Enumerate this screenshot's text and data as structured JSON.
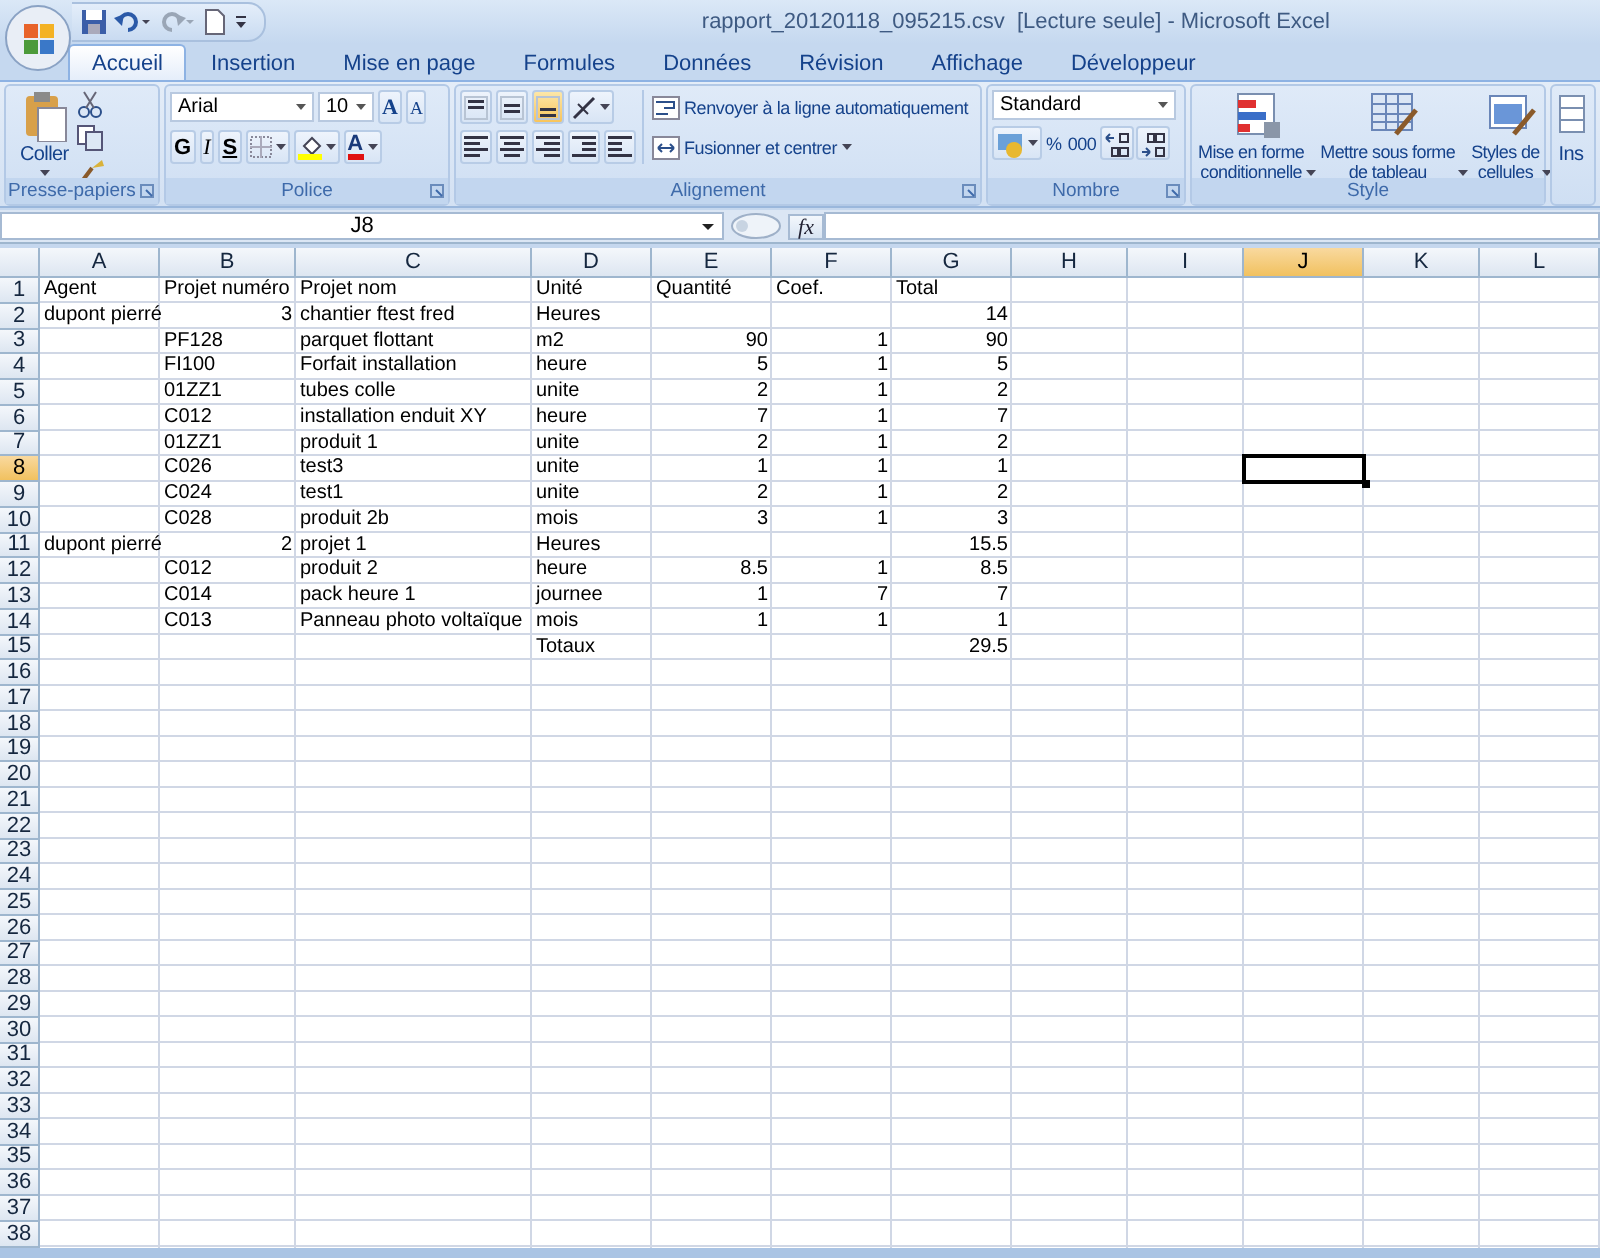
{
  "window": {
    "title": "rapport_20120118_095215.csv  [Lecture seule] - Microsoft Excel"
  },
  "tabs": [
    {
      "label": "Accueil",
      "selected": true
    },
    {
      "label": "Insertion",
      "selected": false
    },
    {
      "label": "Mise en page",
      "selected": false
    },
    {
      "label": "Formules",
      "selected": false
    },
    {
      "label": "Données",
      "selected": false
    },
    {
      "label": "Révision",
      "selected": false
    },
    {
      "label": "Affichage",
      "selected": false
    },
    {
      "label": "Développeur",
      "selected": false
    }
  ],
  "ribbon": {
    "clipboard": {
      "title": "Presse-papiers",
      "paste": "Coller"
    },
    "font": {
      "title": "Police",
      "font_name": "Arial",
      "font_size": "10",
      "grow": "A",
      "shrink": "A",
      "bold": "G",
      "italic": "I",
      "underline": "S",
      "font_color": "A"
    },
    "alignment": {
      "title": "Alignement",
      "wrap": "Renvoyer à la ligne automatiquement",
      "merge": "Fusionner et centrer"
    },
    "number": {
      "title": "Nombre",
      "format": "Standard",
      "percent": "%",
      "thousands": "000"
    },
    "style": {
      "title": "Style",
      "buttons": [
        {
          "label": "Mise en forme\nconditionnelle",
          "kind": "conditional"
        },
        {
          "label": "Mettre sous forme\nde tableau",
          "kind": "table"
        },
        {
          "label": "Styles de\ncellules",
          "kind": "cells"
        }
      ]
    },
    "cells_group": {
      "insert": "Ins"
    }
  },
  "formula_bar": {
    "name_box": "J8",
    "fx": "fx"
  },
  "columns": [
    {
      "label": "A",
      "selected": false
    },
    {
      "label": "B",
      "selected": false
    },
    {
      "label": "C",
      "selected": false
    },
    {
      "label": "D",
      "selected": false
    },
    {
      "label": "E",
      "selected": false
    },
    {
      "label": "F",
      "selected": false
    },
    {
      "label": "G",
      "selected": false
    },
    {
      "label": "H",
      "selected": false
    },
    {
      "label": "I",
      "selected": false
    },
    {
      "label": "J",
      "selected": true
    },
    {
      "label": "K",
      "selected": false
    },
    {
      "label": "L",
      "selected": false
    }
  ],
  "rows": [
    {
      "header": "1",
      "selected": false,
      "cells": {
        "A": {
          "text": "Agent",
          "kind": "text"
        },
        "B": {
          "text": "Projet numéro",
          "kind": "text"
        },
        "C": {
          "text": "Projet nom",
          "kind": "text"
        },
        "D": {
          "text": "Unité",
          "kind": "text"
        },
        "E": {
          "text": "Quantité",
          "kind": "text"
        },
        "F": {
          "text": "Coef.",
          "kind": "text"
        },
        "G": {
          "text": "Total",
          "kind": "text"
        }
      }
    },
    {
      "header": "2",
      "selected": false,
      "cells": {
        "A": {
          "text": "dupont pierré",
          "kind": "text"
        },
        "B": {
          "text": "3",
          "kind": "number"
        },
        "C": {
          "text": "chantier ftest fred",
          "kind": "text"
        },
        "D": {
          "text": "Heures",
          "kind": "text"
        },
        "G": {
          "text": "14",
          "kind": "number"
        }
      }
    },
    {
      "header": "3",
      "selected": false,
      "cells": {
        "B": {
          "text": "PF128",
          "kind": "text"
        },
        "C": {
          "text": "parquet flottant",
          "kind": "text"
        },
        "D": {
          "text": "m2",
          "kind": "text"
        },
        "E": {
          "text": "90",
          "kind": "number"
        },
        "F": {
          "text": "1",
          "kind": "number"
        },
        "G": {
          "text": "90",
          "kind": "number"
        }
      }
    },
    {
      "header": "4",
      "selected": false,
      "cells": {
        "B": {
          "text": "FI100",
          "kind": "text"
        },
        "C": {
          "text": "Forfait installation",
          "kind": "text"
        },
        "D": {
          "text": "heure",
          "kind": "text"
        },
        "E": {
          "text": "5",
          "kind": "number"
        },
        "F": {
          "text": "1",
          "kind": "number"
        },
        "G": {
          "text": "5",
          "kind": "number"
        }
      }
    },
    {
      "header": "5",
      "selected": false,
      "cells": {
        "B": {
          "text": "01ZZ1",
          "kind": "text"
        },
        "C": {
          "text": "tubes colle",
          "kind": "text"
        },
        "D": {
          "text": "unite",
          "kind": "text"
        },
        "E": {
          "text": "2",
          "kind": "number"
        },
        "F": {
          "text": "1",
          "kind": "number"
        },
        "G": {
          "text": "2",
          "kind": "number"
        }
      }
    },
    {
      "header": "6",
      "selected": false,
      "cells": {
        "B": {
          "text": "C012",
          "kind": "text"
        },
        "C": {
          "text": "installation enduit XY",
          "kind": "text"
        },
        "D": {
          "text": "heure",
          "kind": "text"
        },
        "E": {
          "text": "7",
          "kind": "number"
        },
        "F": {
          "text": "1",
          "kind": "number"
        },
        "G": {
          "text": "7",
          "kind": "number"
        }
      }
    },
    {
      "header": "7",
      "selected": false,
      "cells": {
        "B": {
          "text": "01ZZ1",
          "kind": "text"
        },
        "C": {
          "text": "produit 1",
          "kind": "text"
        },
        "D": {
          "text": "unite",
          "kind": "text"
        },
        "E": {
          "text": "2",
          "kind": "number"
        },
        "F": {
          "text": "1",
          "kind": "number"
        },
        "G": {
          "text": "2",
          "kind": "number"
        }
      }
    },
    {
      "header": "8",
      "selected": true,
      "cells": {
        "B": {
          "text": "C026",
          "kind": "text"
        },
        "C": {
          "text": "test3",
          "kind": "text"
        },
        "D": {
          "text": "unite",
          "kind": "text"
        },
        "E": {
          "text": "1",
          "kind": "number"
        },
        "F": {
          "text": "1",
          "kind": "number"
        },
        "G": {
          "text": "1",
          "kind": "number"
        }
      }
    },
    {
      "header": "9",
      "selected": false,
      "cells": {
        "B": {
          "text": "C024",
          "kind": "text"
        },
        "C": {
          "text": "test1",
          "kind": "text"
        },
        "D": {
          "text": "unite",
          "kind": "text"
        },
        "E": {
          "text": "2",
          "kind": "number"
        },
        "F": {
          "text": "1",
          "kind": "number"
        },
        "G": {
          "text": "2",
          "kind": "number"
        }
      }
    },
    {
      "header": "10",
      "selected": false,
      "cells": {
        "B": {
          "text": "C028",
          "kind": "text"
        },
        "C": {
          "text": "produit 2b",
          "kind": "text"
        },
        "D": {
          "text": "mois",
          "kind": "text"
        },
        "E": {
          "text": "3",
          "kind": "number"
        },
        "F": {
          "text": "1",
          "kind": "number"
        },
        "G": {
          "text": "3",
          "kind": "number"
        }
      }
    },
    {
      "header": "11",
      "selected": false,
      "cells": {
        "A": {
          "text": "dupont pierré",
          "kind": "text"
        },
        "B": {
          "text": "2",
          "kind": "number"
        },
        "C": {
          "text": "projet 1",
          "kind": "text"
        },
        "D": {
          "text": "Heures",
          "kind": "text"
        },
        "G": {
          "text": "15.5",
          "kind": "number"
        }
      }
    },
    {
      "header": "12",
      "selected": false,
      "cells": {
        "B": {
          "text": "C012",
          "kind": "text"
        },
        "C": {
          "text": "produit 2",
          "kind": "text"
        },
        "D": {
          "text": "heure",
          "kind": "text"
        },
        "E": {
          "text": "8.5",
          "kind": "number"
        },
        "F": {
          "text": "1",
          "kind": "number"
        },
        "G": {
          "text": "8.5",
          "kind": "number"
        }
      }
    },
    {
      "header": "13",
      "selected": false,
      "cells": {
        "B": {
          "text": "C014",
          "kind": "text"
        },
        "C": {
          "text": "pack heure 1",
          "kind": "text"
        },
        "D": {
          "text": "journee",
          "kind": "text"
        },
        "E": {
          "text": "1",
          "kind": "number"
        },
        "F": {
          "text": "7",
          "kind": "number"
        },
        "G": {
          "text": "7",
          "kind": "number"
        }
      }
    },
    {
      "header": "14",
      "selected": false,
      "cells": {
        "B": {
          "text": "C013",
          "kind": "text"
        },
        "C": {
          "text": "Panneau photo voltaïque",
          "kind": "text"
        },
        "D": {
          "text": "mois",
          "kind": "text"
        },
        "E": {
          "text": "1",
          "kind": "number"
        },
        "F": {
          "text": "1",
          "kind": "number"
        },
        "G": {
          "text": "1",
          "kind": "number"
        }
      }
    },
    {
      "header": "15",
      "selected": false,
      "cells": {
        "D": {
          "text": "Totaux",
          "kind": "text"
        },
        "G": {
          "text": "29.5",
          "kind": "number"
        }
      }
    },
    {
      "header": "16",
      "selected": false
    },
    {
      "header": "17",
      "selected": false
    },
    {
      "header": "18",
      "selected": false
    },
    {
      "header": "19",
      "selected": false
    },
    {
      "header": "20",
      "selected": false
    },
    {
      "header": "21",
      "selected": false
    },
    {
      "header": "22",
      "selected": false
    },
    {
      "header": "23",
      "selected": false
    },
    {
      "header": "24",
      "selected": false
    },
    {
      "header": "25",
      "selected": false
    },
    {
      "header": "26",
      "selected": false
    },
    {
      "header": "27",
      "selected": false
    },
    {
      "header": "28",
      "selected": false
    },
    {
      "header": "29",
      "selected": false
    },
    {
      "header": "30",
      "selected": false
    },
    {
      "header": "31",
      "selected": false
    },
    {
      "header": "32",
      "selected": false
    },
    {
      "header": "33",
      "selected": false
    },
    {
      "header": "34",
      "selected": false
    },
    {
      "header": "35",
      "selected": false
    },
    {
      "header": "36",
      "selected": false
    },
    {
      "header": "37",
      "selected": false
    },
    {
      "header": "38",
      "selected": false
    }
  ]
}
